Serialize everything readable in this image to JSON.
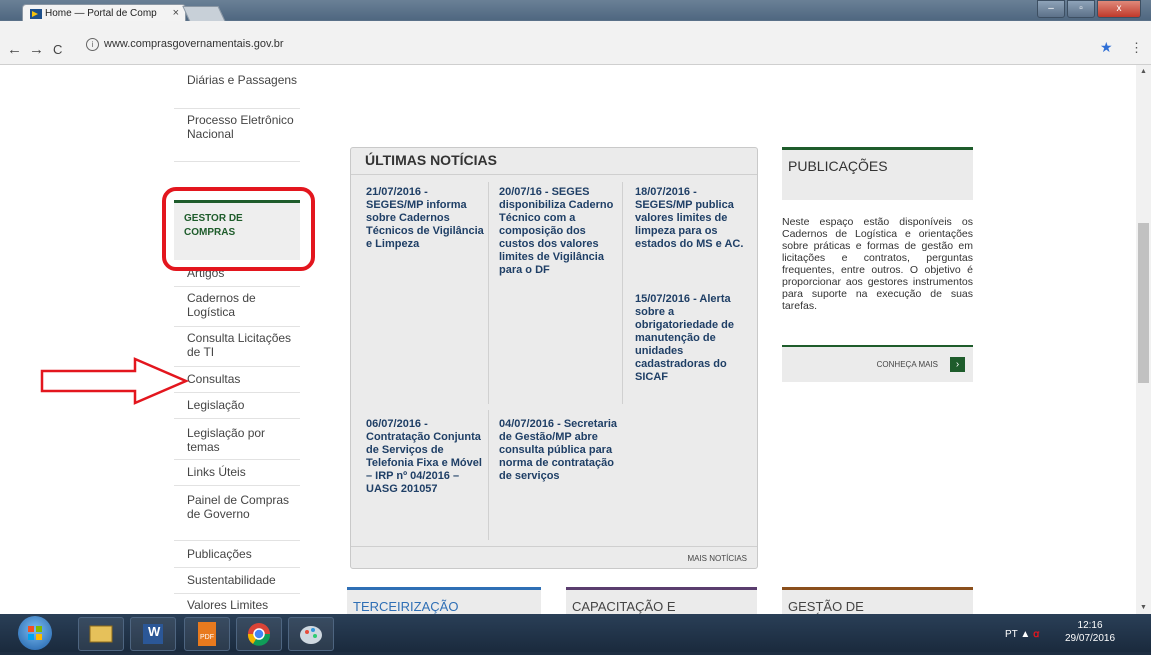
{
  "browser": {
    "tab_title": "Home — Portal de Comp",
    "tab_close": "×",
    "url": "www.comprasgovernamentais.gov.br",
    "info_glyph": "i",
    "back": "←",
    "forward": "→",
    "reload": "C",
    "star": "★",
    "menu": "⋮",
    "window_buttons": [
      "‒",
      "▫",
      "x"
    ]
  },
  "sidebar": {
    "items": [
      "Diárias e Passagens",
      "Processo Eletrônico Nacional",
      "Artigos",
      "Cadernos de Logística",
      "Consulta Licitações de TI",
      "Consultas",
      "Legislação",
      "Legislação por temas",
      "Links Úteis",
      "Painel de Compras de Governo",
      "Publicações",
      "Sustentabilidade",
      "Valores Limites"
    ],
    "highlight": "GESTOR DE COMPRAS"
  },
  "news": {
    "title": "ÚLTIMAS NOTÍCIAS",
    "items": [
      "21/07/2016 - SEGES/MP informa sobre Cadernos Técnicos de Vigilância e Limpeza",
      "20/07/16 - SEGES disponibiliza Caderno Técnico com a composição dos custos dos valores limites de Vigilância para o DF",
      "18/07/2016 - SEGES/MP publica valores limites de limpeza para os estados do MS e AC.",
      "15/07/2016 - Alerta sobre a obrigatoriedade de manutenção de unidades cadastradoras do SICAF",
      "06/07/2016 - Contratação Conjunta de Serviços de Telefonia Fixa e Móvel – IRP nº 04/2016 – UASG 201057",
      "04/07/2016 - Secretaria de Gestão/MP abre consulta pública para norma de contratação de serviços"
    ],
    "more": "MAIS NOTÍCIAS"
  },
  "publications": {
    "title": "PUBLICAÇÕES",
    "text": "Neste espaço estão disponíveis os Cadernos de Logística e orientações sobre práticas e formas de gestão em licitações e contratos, perguntas frequentes, entre outros. O objetivo é proporcionar aos gestores instrumentos para suporte na execução de suas tarefas.",
    "link": "CONHEÇA MAIS",
    "link_icon": "›"
  },
  "bottom_boxes": [
    {
      "label": "TERCEIRIZAÇÃO",
      "color": "#2f6fb5"
    },
    {
      "label": "CAPACITAÇÃO E EVENTOS",
      "color": "#5a3d6e"
    },
    {
      "label": "GESTÃO DE LOGÍSTICA",
      "color": "#8a4f1c"
    }
  ],
  "taskbar": {
    "apps": [
      "file-explorer-icon",
      "word-icon",
      "pdf-icon",
      "chrome-icon",
      "paint-icon"
    ],
    "app_labels": [
      "",
      "W",
      "PDF",
      "",
      ""
    ],
    "language": "PT",
    "time": "12:16",
    "date": "29/07/2016"
  },
  "colors": {
    "accent_green": "#1e5c2b",
    "news_link": "#1f3f66",
    "annotation_red": "#e3161e"
  }
}
